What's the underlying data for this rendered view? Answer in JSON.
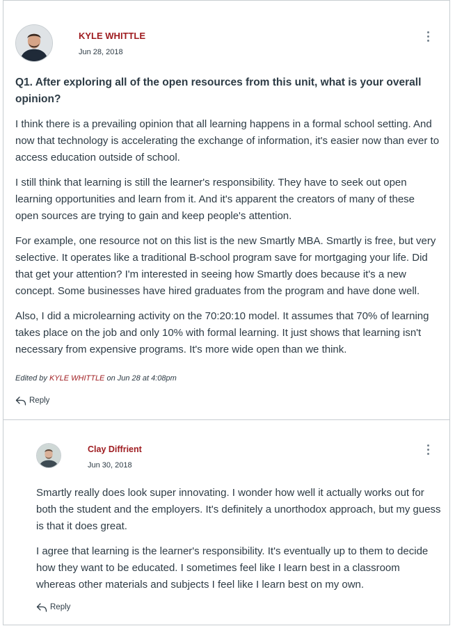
{
  "main_post": {
    "author": "KYLE WHITTLE",
    "date": "Jun 28, 2018",
    "title": "Q1. After exploring all of the open resources from this unit, what is your overall opinion?",
    "paragraphs": [
      "I think there is a prevailing opinion that all learning happens in a formal school setting. And now that technology is accelerating the exchange of information, it's easier now than ever to access education outside of school.",
      "I still think that learning is still the learner's responsibility. They have to seek out open learning opportunities and learn from it. And it's apparent the creators of many of these open sources are trying to gain and keep people's attention.",
      "For example, one resource not on this list is the new Smartly MBA. Smartly is free, but very selective. It operates like a traditional B-school program save for mortgaging your life. Did that get your attention? I'm interested in seeing how Smartly does because it's a new concept. Some businesses have hired graduates from the program and have done well.",
      "Also, I did a microlearning activity on the 70:20:10 model. It assumes that 70% of learning takes place on the job and only 10% with formal learning. It just shows that learning isn't necessary from expensive programs. It's more wide open than we think."
    ],
    "edited": {
      "prefix": "Edited by",
      "by": "KYLE WHITTLE",
      "suffix": "on Jun 28 at 4:08pm"
    },
    "reply_label": "Reply"
  },
  "reply_post": {
    "author": "Clay Diffrient",
    "date": "Jun 30, 2018",
    "paragraphs": [
      "Smartly really does look super innovating.  I wonder how well it actually works out for both the student and the employers.  It's definitely a unorthodox approach, but my guess is that it does great.",
      "I agree that learning is the learner's responsibility.  It's eventually up to them to decide how they want to be educated.  I sometimes feel like I learn best in a classroom whereas other materials and subjects I feel like I learn best on my own."
    ],
    "reply_label": "Reply"
  },
  "icons": {
    "more": "kebab-menu-icon",
    "reply": "reply-arrow-icon",
    "avatar": "user-avatar"
  },
  "colors": {
    "author_link": "#9e1b1f",
    "text": "#2d3b45",
    "border": "#c7cdd1"
  }
}
